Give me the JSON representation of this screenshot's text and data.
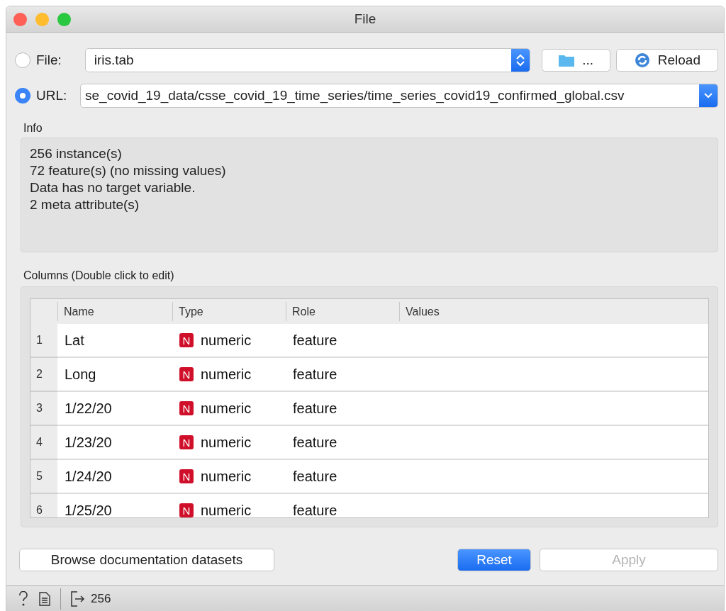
{
  "window": {
    "title": "File"
  },
  "source": {
    "options": [
      {
        "label": "File:",
        "selected": false
      },
      {
        "label": "URL:",
        "selected": true
      }
    ],
    "file_value": "iris.tab",
    "browse_button": "...",
    "reload_button": "Reload",
    "url_value": "se_covid_19_data/csse_covid_19_time_series/time_series_covid19_confirmed_global.csv"
  },
  "info": {
    "label": "Info",
    "lines": [
      "256 instance(s)",
      "72 feature(s) (no missing values)",
      "Data has no target variable.",
      "2 meta attribute(s)"
    ]
  },
  "columns": {
    "label": "Columns (Double click to edit)",
    "headers": [
      "Name",
      "Type",
      "Role",
      "Values"
    ],
    "rows": [
      {
        "index": "1",
        "name": "Lat",
        "type_badge": "N",
        "type": "numeric",
        "role": "feature"
      },
      {
        "index": "2",
        "name": "Long",
        "type_badge": "N",
        "type": "numeric",
        "role": "feature"
      },
      {
        "index": "3",
        "name": "1/22/20",
        "type_badge": "N",
        "type": "numeric",
        "role": "feature"
      },
      {
        "index": "4",
        "name": "1/23/20",
        "type_badge": "N",
        "type": "numeric",
        "role": "feature"
      },
      {
        "index": "5",
        "name": "1/24/20",
        "type_badge": "N",
        "type": "numeric",
        "role": "feature"
      },
      {
        "index": "6",
        "name": "1/25/20",
        "type_badge": "N",
        "type": "numeric",
        "role": "feature"
      }
    ]
  },
  "buttons": [
    {
      "label": "Browse documentation datasets",
      "kind": "plain",
      "disabled": false
    },
    {
      "label": "Reset",
      "kind": "primary",
      "disabled": false
    },
    {
      "label": "Apply",
      "kind": "plain",
      "disabled": true
    }
  ],
  "status_bar": {
    "output_count": "256"
  }
}
